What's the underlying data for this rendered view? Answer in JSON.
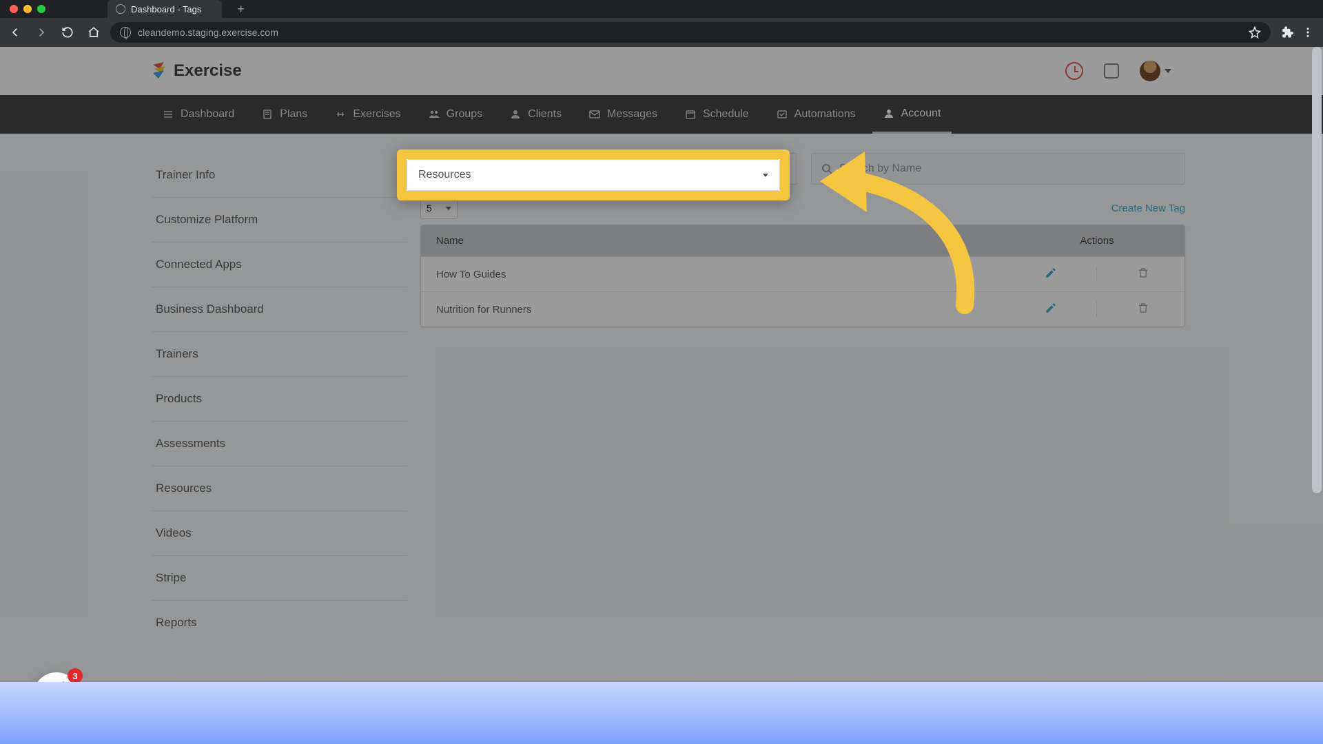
{
  "browser": {
    "tab_title": "Dashboard - Tags",
    "url": "cleandemo.staging.exercise.com"
  },
  "header": {
    "brand": "Exercise"
  },
  "nav": {
    "items": [
      {
        "label": "Dashboard"
      },
      {
        "label": "Plans"
      },
      {
        "label": "Exercises"
      },
      {
        "label": "Groups"
      },
      {
        "label": "Clients"
      },
      {
        "label": "Messages"
      },
      {
        "label": "Schedule"
      },
      {
        "label": "Automations"
      },
      {
        "label": "Account"
      }
    ]
  },
  "sidebar": {
    "items": [
      {
        "label": "Trainer Info"
      },
      {
        "label": "Customize Platform"
      },
      {
        "label": "Connected Apps"
      },
      {
        "label": "Business Dashboard"
      },
      {
        "label": "Trainers"
      },
      {
        "label": "Products"
      },
      {
        "label": "Assessments"
      },
      {
        "label": "Resources"
      },
      {
        "label": "Videos"
      },
      {
        "label": "Stripe"
      },
      {
        "label": "Reports"
      }
    ]
  },
  "filters": {
    "category_selected": "Resources",
    "search_placeholder": "Search by Name"
  },
  "toolbar": {
    "pagesize": "5",
    "create_label": "Create New Tag"
  },
  "table": {
    "columns": {
      "name": "Name",
      "actions": "Actions"
    },
    "rows": [
      {
        "name": "How To Guides"
      },
      {
        "name": "Nutrition for Runners"
      }
    ]
  },
  "intercom": {
    "badge": "3"
  }
}
